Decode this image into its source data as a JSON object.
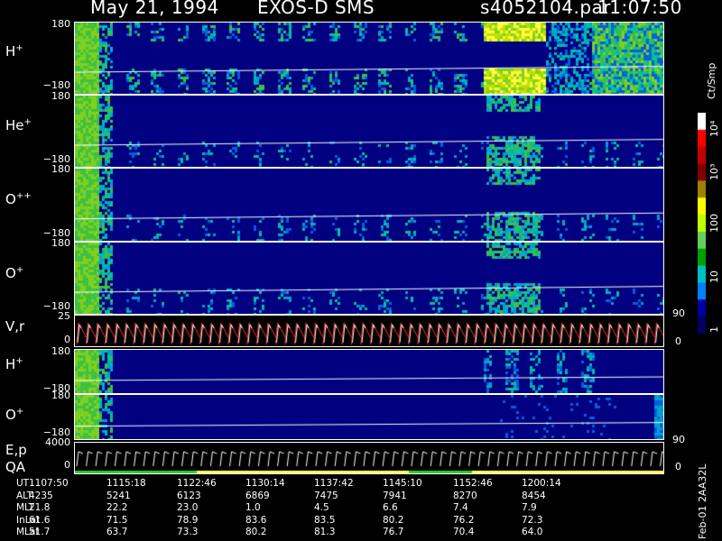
{
  "header": {
    "date": "May 21, 1994",
    "instrument": "EXOS-D SMS",
    "file": "s4052104.par",
    "time": "11:07:50"
  },
  "colorbar": {
    "unit": "Ct/Smp",
    "ticks": [
      "10⁴",
      "10³",
      "100",
      "10",
      "1"
    ],
    "colors": [
      "#ffffff",
      "#ff0000",
      "#c00000",
      "#800000",
      "#a08000",
      "#ffff00",
      "#c0ff00",
      "#60d060",
      "#00a000",
      "#00c0c0",
      "#0080ff",
      "#0000a0",
      "#000060"
    ]
  },
  "panels": [
    {
      "label": "H",
      "sup": "+",
      "top": "180",
      "bottom": "−180"
    },
    {
      "label": "He",
      "sup": "+",
      "top": "180",
      "bottom": "−180"
    },
    {
      "label": "O",
      "sup": "++",
      "top": "180",
      "bottom": "−180"
    },
    {
      "label": "O",
      "sup": "+",
      "top": "180",
      "bottom": "−180"
    },
    {
      "label": "V,r",
      "sup": "",
      "top": "25",
      "bottom": "0"
    },
    {
      "label": "H",
      "sup": "+",
      "top": "180",
      "bottom": "−180"
    },
    {
      "label": "O",
      "sup": "+",
      "top": "180",
      "bottom": "−180"
    },
    {
      "label": "E,p",
      "sup": "",
      "top": "4000",
      "bottom": "0"
    }
  ],
  "qa_label": "QA",
  "right_axis": {
    "vr_top": "90",
    "vr_bottom": "0",
    "ep_top": "90",
    "ep_bottom": "0"
  },
  "chart_data": {
    "type": "heatmap",
    "title": "May 21, 1994   EXOS-D SMS",
    "x_ticks": [
      "1107:50",
      "1115:18",
      "1122:46",
      "1130:14",
      "1137:42",
      "1145:10",
      "1152:46",
      "1200:14"
    ],
    "colorbar_label": "Ct/Smp",
    "colorbar_range": [
      1,
      10000
    ],
    "log_scale": true,
    "ylim_pitch": [
      -180,
      180
    ]
  },
  "table": {
    "rows": [
      {
        "label": "UT",
        "values": [
          "1107:50",
          "1115:18",
          "1122:46",
          "1130:14",
          "1137:42",
          "1145:10",
          "1152:46",
          "1200:14"
        ]
      },
      {
        "label": "ALT",
        "values": [
          "4235",
          "5241",
          "6123",
          "6869",
          "7475",
          "7941",
          "8270",
          "8454"
        ]
      },
      {
        "label": "MLT",
        "values": [
          "21.8",
          "22.2",
          "23.0",
          "1.0",
          "4.5",
          "6.6",
          "7.4",
          "7.9"
        ]
      },
      {
        "label": "InLat",
        "values": [
          "61.6",
          "71.5",
          "78.9",
          "83.6",
          "83.5",
          "80.2",
          "76.2",
          "72.3"
        ]
      },
      {
        "label": "MLat",
        "values": [
          "51.7",
          "63.7",
          "73.3",
          "80.2",
          "81.3",
          "76.7",
          "70.4",
          "64.0"
        ]
      }
    ]
  },
  "footer_side": "Feb-01 2AA32L"
}
